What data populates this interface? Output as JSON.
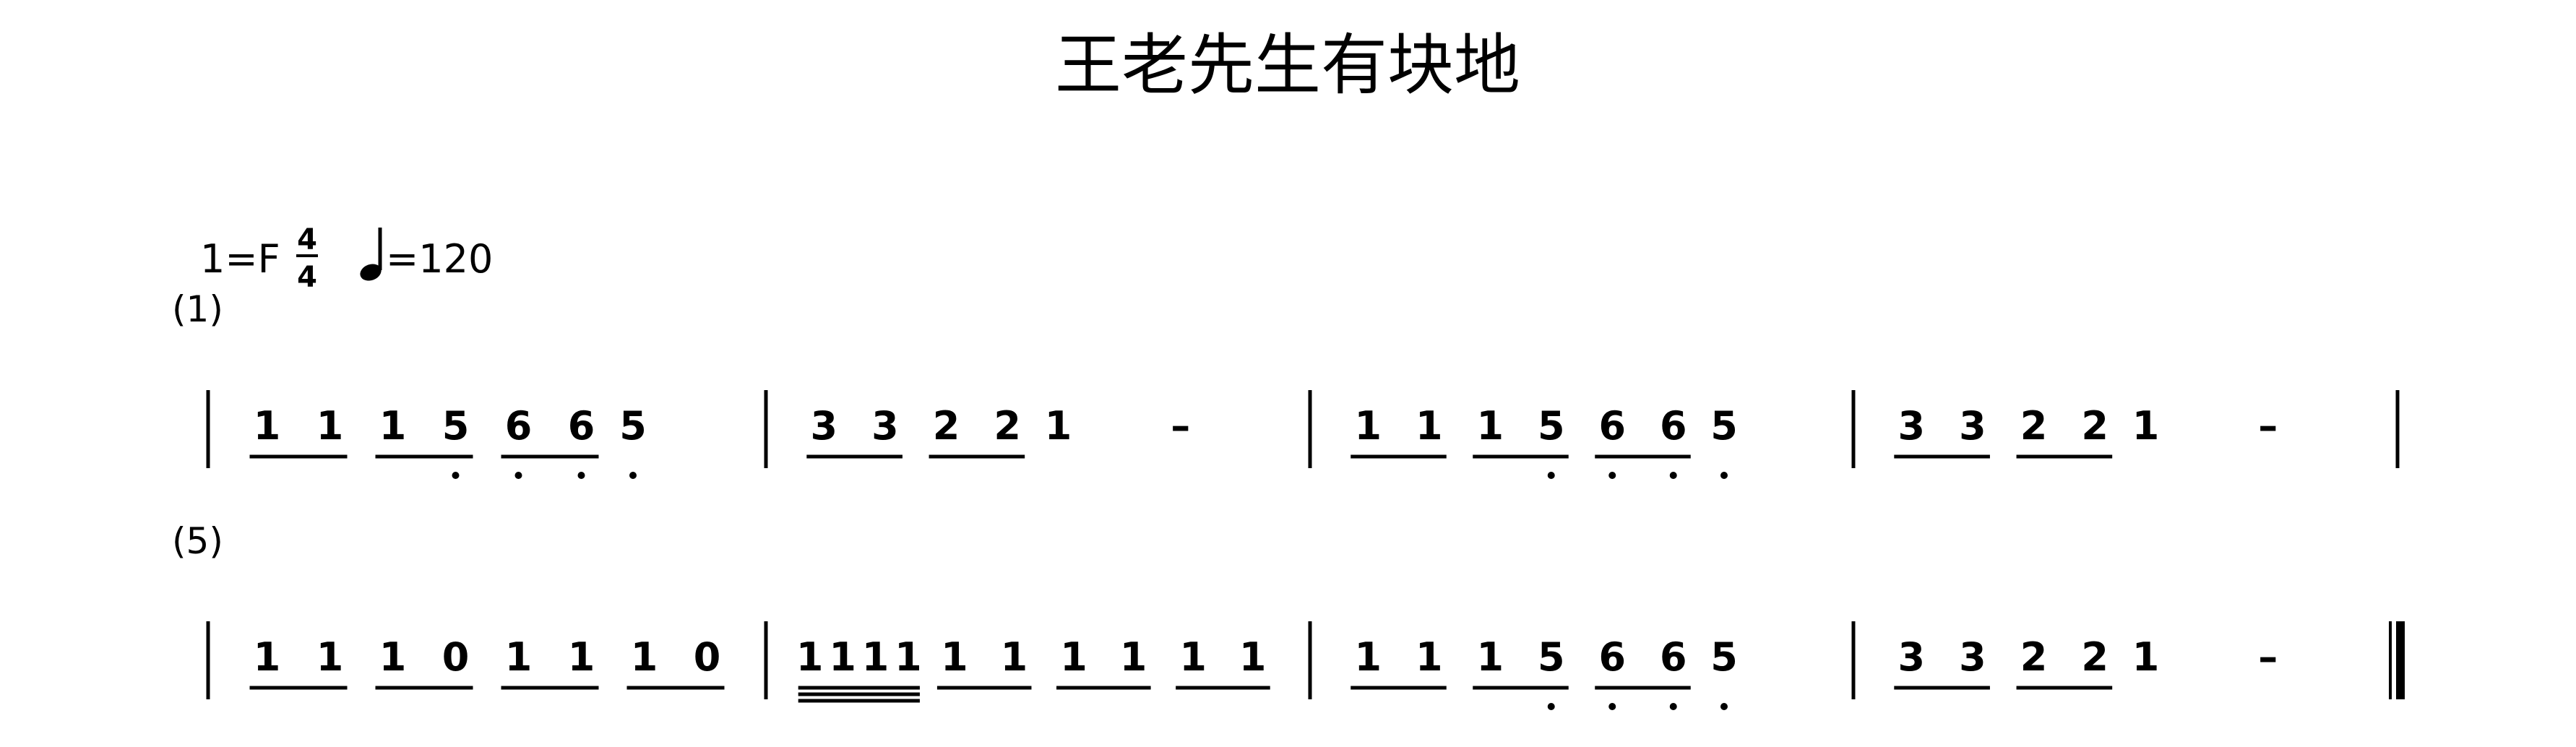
{
  "title": "王老先生有块地",
  "header": {
    "key": "1=F",
    "time_top": "4",
    "time_bottom": "4",
    "tempo": "=120"
  },
  "systems": [
    {
      "label": "(1)",
      "final_barline": "single",
      "measures": [
        [
          {
            "n": "1",
            "u": 1
          },
          {
            "n": "1",
            "u": 1
          },
          {
            "n": "1",
            "u": 1
          },
          {
            "n": "5",
            "u": 1,
            "dot": "below"
          },
          {
            "n": "6",
            "u": 1,
            "dot": "below"
          },
          {
            "n": "6",
            "u": 1,
            "dot": "below"
          },
          {
            "n": "5",
            "u": 0,
            "dot": "below"
          }
        ],
        [
          {
            "n": "3",
            "u": 1
          },
          {
            "n": "3",
            "u": 1
          },
          {
            "n": "2",
            "u": 1
          },
          {
            "n": "2",
            "u": 1
          },
          {
            "n": "1",
            "u": 0
          },
          {
            "n": "–",
            "u": 0
          }
        ],
        [
          {
            "n": "1",
            "u": 1
          },
          {
            "n": "1",
            "u": 1
          },
          {
            "n": "1",
            "u": 1
          },
          {
            "n": "5",
            "u": 1,
            "dot": "below"
          },
          {
            "n": "6",
            "u": 1,
            "dot": "below"
          },
          {
            "n": "6",
            "u": 1,
            "dot": "below"
          },
          {
            "n": "5",
            "u": 0,
            "dot": "below"
          }
        ],
        [
          {
            "n": "3",
            "u": 1
          },
          {
            "n": "3",
            "u": 1
          },
          {
            "n": "2",
            "u": 1
          },
          {
            "n": "2",
            "u": 1
          },
          {
            "n": "1",
            "u": 0
          },
          {
            "n": "–",
            "u": 0
          }
        ]
      ]
    },
    {
      "label": "(5)",
      "final_barline": "final",
      "measures": [
        [
          {
            "n": "1",
            "u": 1
          },
          {
            "n": "1",
            "u": 1
          },
          {
            "n": "1",
            "u": 1
          },
          {
            "n": "0",
            "u": 1
          },
          {
            "n": "1",
            "u": 1
          },
          {
            "n": "1",
            "u": 1
          },
          {
            "n": "1",
            "u": 1
          },
          {
            "n": "0",
            "u": 1
          }
        ],
        [
          {
            "n": "1",
            "u": 3
          },
          {
            "n": "1",
            "u": 3
          },
          {
            "n": "1",
            "u": 3
          },
          {
            "n": "1",
            "u": 3
          },
          {
            "n": "1",
            "u": 1
          },
          {
            "n": "1",
            "u": 1
          },
          {
            "n": "1",
            "u": 1
          },
          {
            "n": "1",
            "u": 1
          },
          {
            "n": "1",
            "u": 1
          },
          {
            "n": "1",
            "u": 1
          }
        ],
        [
          {
            "n": "1",
            "u": 1
          },
          {
            "n": "1",
            "u": 1
          },
          {
            "n": "1",
            "u": 1
          },
          {
            "n": "5",
            "u": 1,
            "dot": "below"
          },
          {
            "n": "6",
            "u": 1,
            "dot": "below"
          },
          {
            "n": "6",
            "u": 1,
            "dot": "below"
          },
          {
            "n": "5",
            "u": 0,
            "dot": "below"
          }
        ],
        [
          {
            "n": "3",
            "u": 1
          },
          {
            "n": "3",
            "u": 1
          },
          {
            "n": "2",
            "u": 1
          },
          {
            "n": "2",
            "u": 1
          },
          {
            "n": "1",
            "u": 0
          },
          {
            "n": "–",
            "u": 0
          }
        ]
      ]
    }
  ]
}
